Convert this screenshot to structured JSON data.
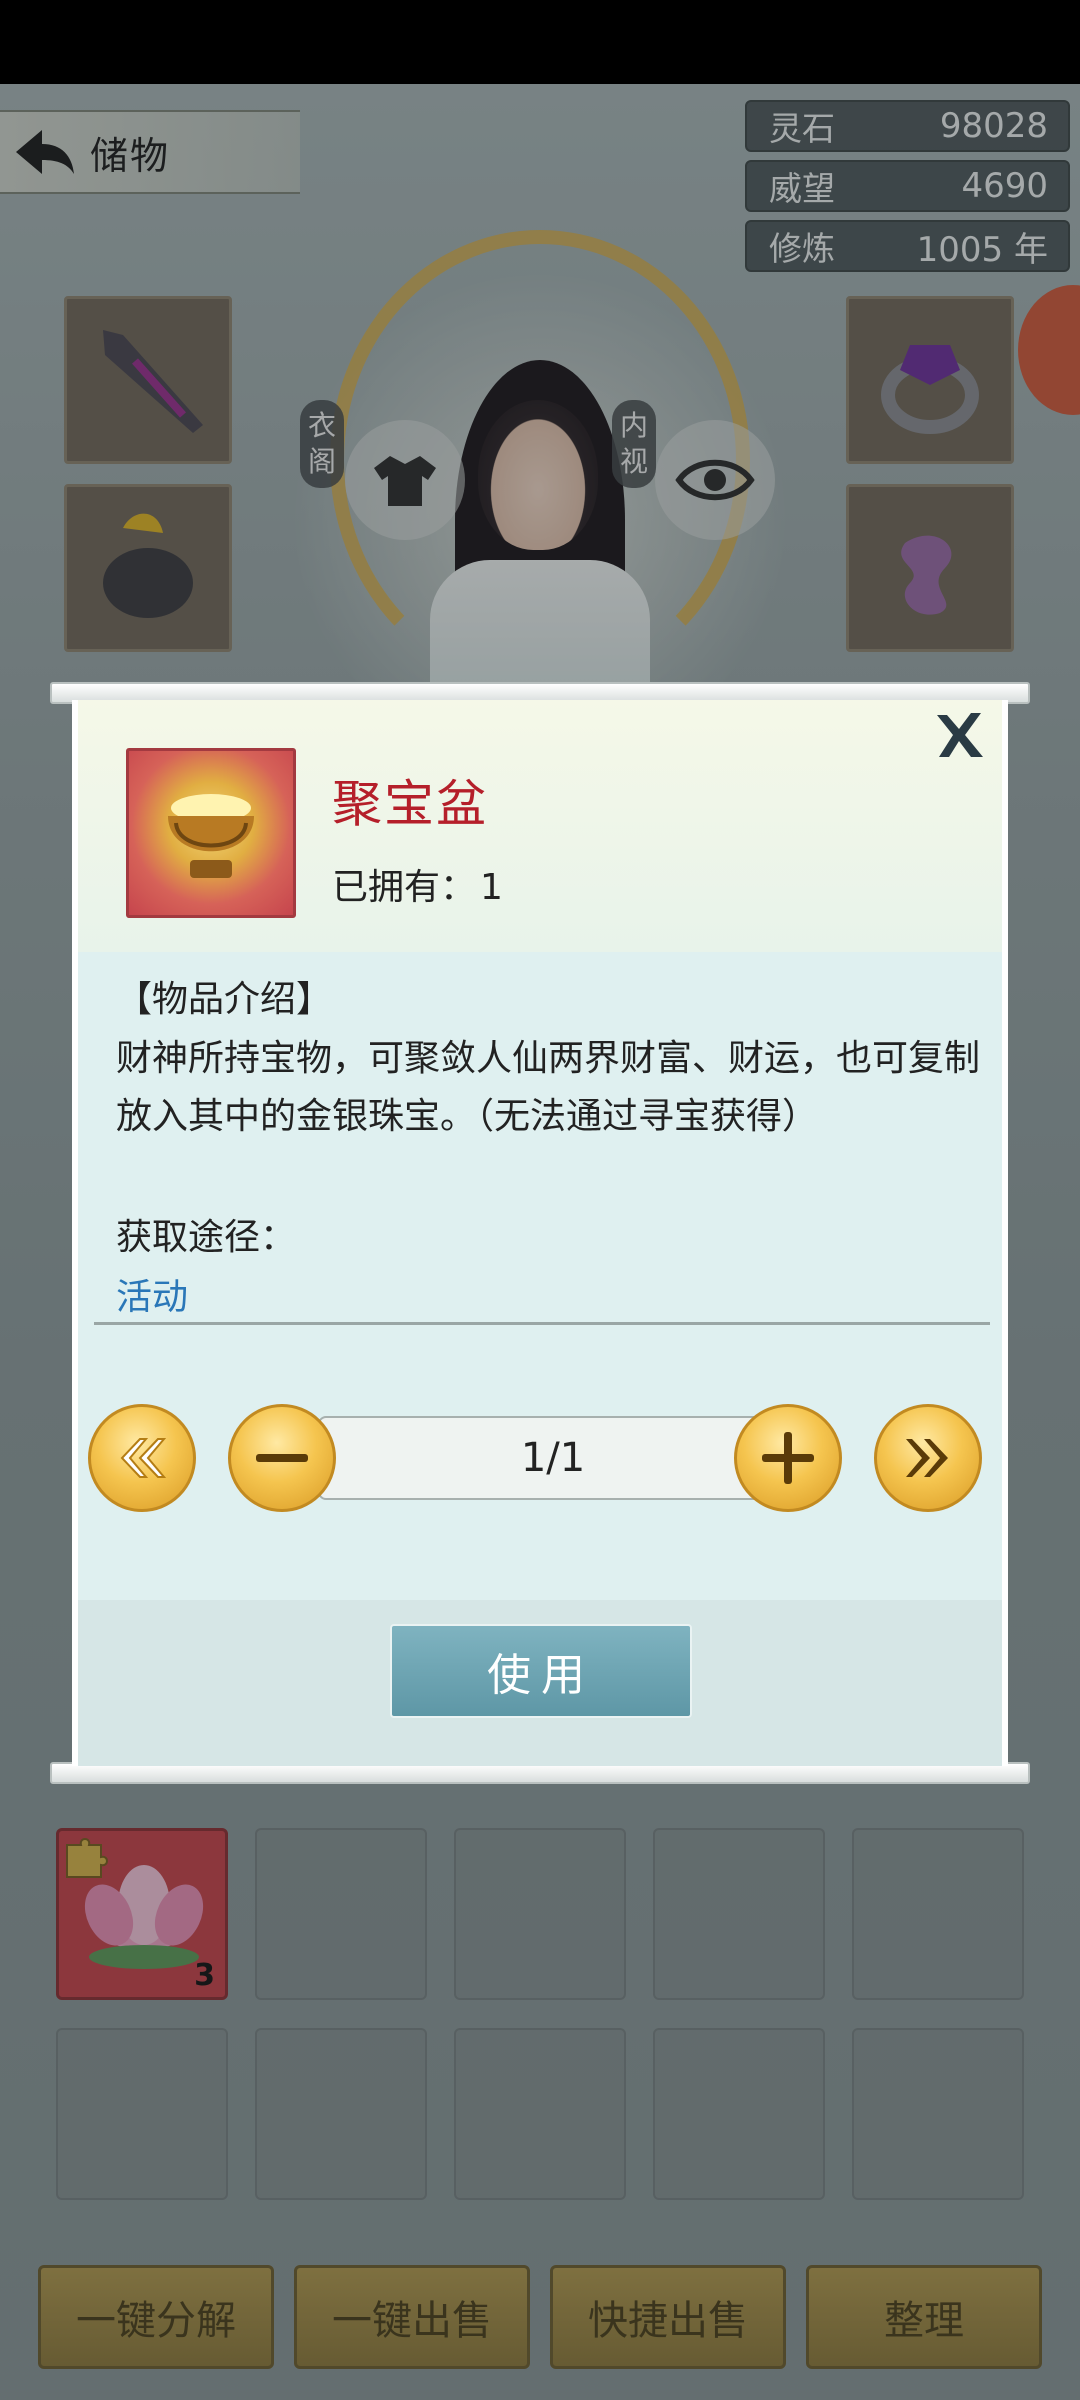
{
  "header": {
    "title": "储物"
  },
  "stats": [
    {
      "label": "灵石",
      "value": "98028"
    },
    {
      "label": "威望",
      "value": "4690"
    },
    {
      "label": "修炼",
      "value": "1005 年"
    }
  ],
  "character": {
    "left_button_label": "衣\n阁",
    "right_button_label": "内\n视"
  },
  "inventory": {
    "lotus_count": "3"
  },
  "bottom_actions": {
    "decompose": "一键分解",
    "sell_all": "一键出售",
    "quick_sell": "快捷出售",
    "sort": "整理"
  },
  "modal": {
    "item_name": "聚宝盆",
    "owned_label": "已拥有：",
    "owned_value": "1",
    "intro_title": "【物品介绍】",
    "description": "财神所持宝物，可聚敛人仙两界财富、财运，也可复制放入其中的金银珠宝。（无法通过寻宝获得）",
    "source_title": "获取途径：",
    "source_link": "活动",
    "quantity": "1/1",
    "use_label": "使用"
  },
  "colors": {
    "item_name": "#b51f2a",
    "link": "#2a77b8",
    "use_button": "#6aa3b1",
    "gold_button": "#f5c54f"
  },
  "icons": [
    "back-arrow-icon",
    "close-x-icon",
    "first-page-icon",
    "minus-icon",
    "plus-icon",
    "last-page-icon",
    "wardrobe-icon",
    "eye-icon"
  ]
}
